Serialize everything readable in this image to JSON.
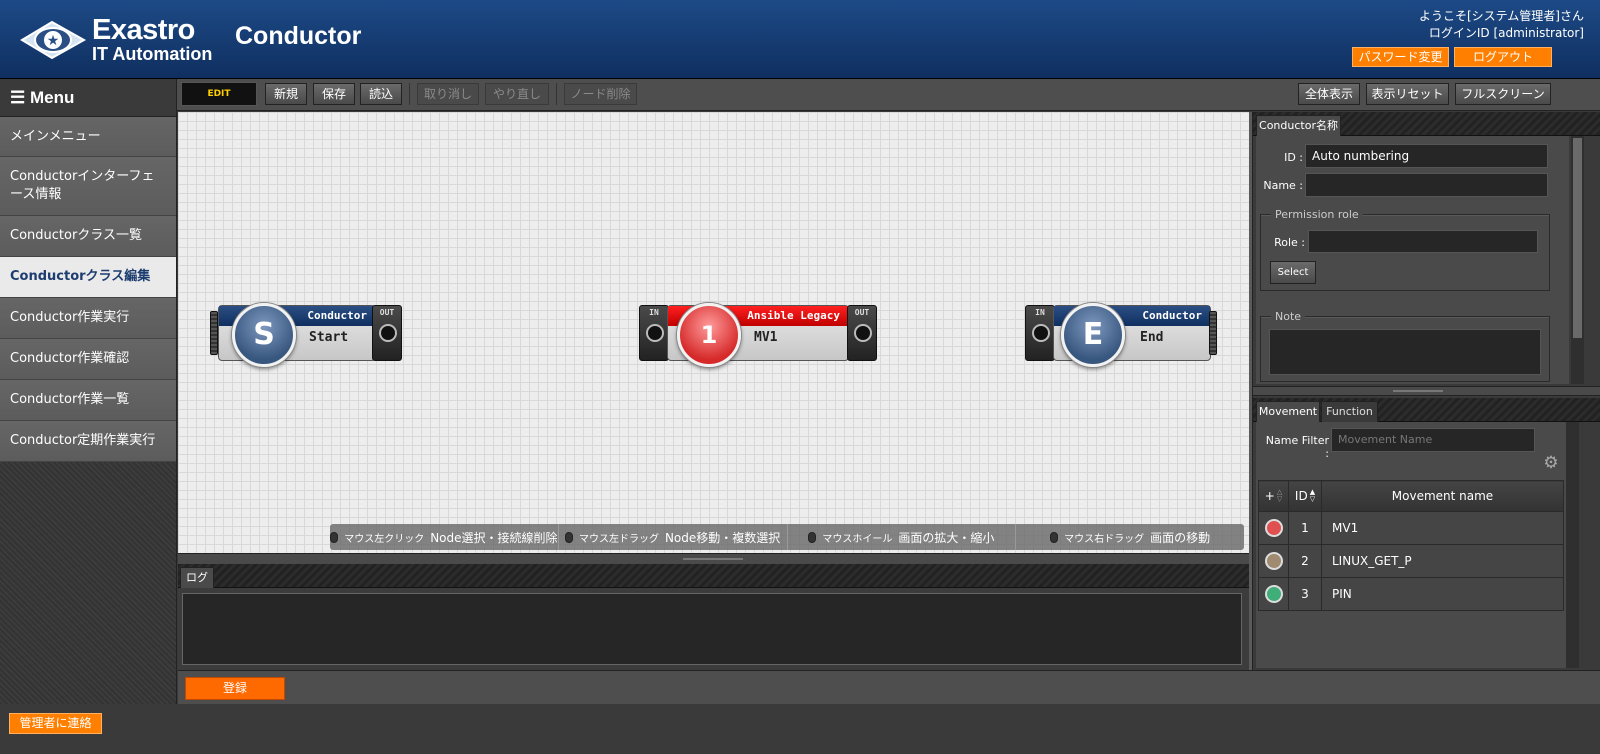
{
  "header": {
    "logo_line1": "Exastro",
    "logo_line2": "IT Automation",
    "app_title": "Conductor",
    "welcome": "ようこそ[システム管理者]さん",
    "login_id": "ログインID [administrator]",
    "password_change": "パスワード変更",
    "logout": "ログアウト"
  },
  "sidebar": {
    "menu_title": "☰ Menu",
    "items": [
      {
        "label": "メインメニュー"
      },
      {
        "label": "Conductorインターフェース情報"
      },
      {
        "label": "Conductorクラス一覧"
      },
      {
        "label": "Conductorクラス編集"
      },
      {
        "label": "Conductor作業実行"
      },
      {
        "label": "Conductor作業確認"
      },
      {
        "label": "Conductor作業一覧"
      },
      {
        "label": "Conductor定期作業実行"
      }
    ],
    "active_index": 3
  },
  "toolbar": {
    "mode": "EDIT",
    "new": "新規",
    "save": "保存",
    "load": "読込",
    "undo": "取り消し",
    "redo": "やり直し",
    "delete_node": "ノード削除",
    "show_all": "全体表示",
    "reset_view": "表示リセット",
    "fullscreen": "フルスクリーン"
  },
  "nodes": {
    "start": {
      "symbol": "S",
      "type": "Conductor",
      "name": "Start",
      "out": "OUT"
    },
    "movement": {
      "symbol": "1",
      "type": "Ansible Legacy",
      "name": "MV1",
      "in": "IN",
      "out": "OUT"
    },
    "end": {
      "symbol": "E",
      "type": "Conductor",
      "name": "End",
      "in": "IN"
    }
  },
  "hints": [
    {
      "action": "マウス左クリック",
      "desc": "Node選択・接続線削除"
    },
    {
      "action": "マウス左ドラッグ",
      "desc": "Node移動・複数選択"
    },
    {
      "action": "マウスホイール",
      "desc": "画面の拡大・縮小"
    },
    {
      "action": "マウス右ドラッグ",
      "desc": "画面の移動"
    }
  ],
  "log": {
    "tab": "ログ"
  },
  "register": "登録",
  "properties": {
    "tab": "Conductor名称",
    "id_label": "ID :",
    "id_value": "Auto numbering",
    "name_label": "Name :",
    "name_value": "",
    "permission_legend": "Permission role",
    "role_label": "Role :",
    "role_value": "",
    "select": "Select",
    "note_legend": "Note"
  },
  "movement_panel": {
    "tabs": [
      "Movement",
      "Function"
    ],
    "filter_label": "Name Filter :",
    "filter_placeholder": "Movement Name",
    "columns": {
      "plus": "+",
      "id": "ID",
      "name": "Movement name"
    },
    "rows": [
      {
        "id": "1",
        "name": "MV1",
        "color": "#e05050"
      },
      {
        "id": "2",
        "name": "LINUX_GET_P",
        "color": "#a08a70"
      },
      {
        "id": "3",
        "name": "PIN",
        "color": "#3fae78"
      }
    ]
  },
  "footer": {
    "contact": "管理者に連絡"
  },
  "colors": {
    "accent": "#ff8000",
    "header": "#1d4a86"
  }
}
